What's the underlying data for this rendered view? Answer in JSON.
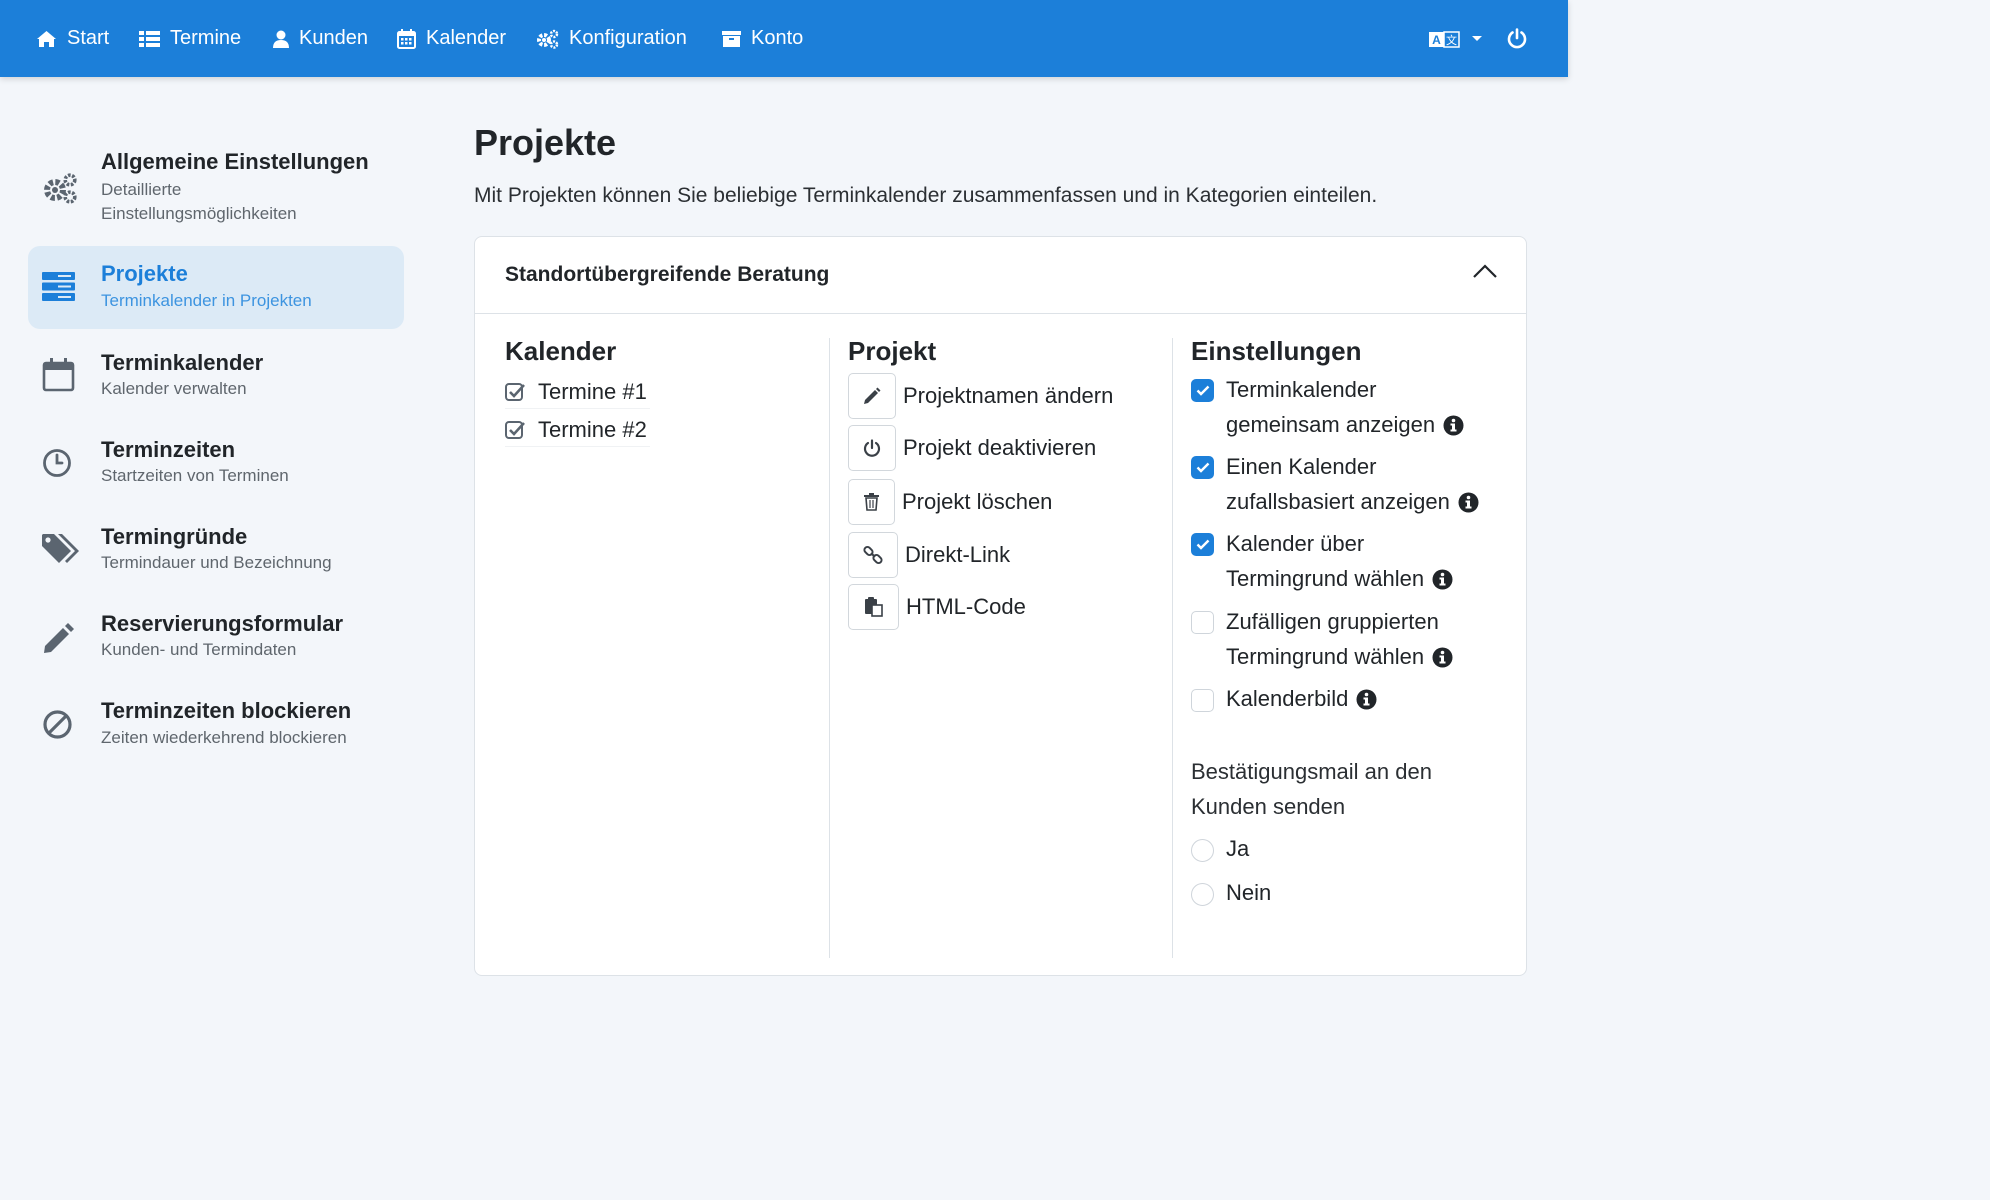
{
  "nav": {
    "items": [
      {
        "label": "Start",
        "icon": "home-icon"
      },
      {
        "label": "Termine",
        "icon": "list-icon"
      },
      {
        "label": "Kunden",
        "icon": "user-icon"
      },
      {
        "label": "Kalender",
        "icon": "calendar-icon"
      },
      {
        "label": "Konfiguration",
        "icon": "cogs-icon"
      },
      {
        "label": "Konto",
        "icon": "archive-icon"
      }
    ],
    "right": {
      "language_icon": "translate-icon",
      "logout_icon": "power-icon"
    },
    "colors": {
      "bar": "#1c7fd9",
      "text": "#ffffff"
    }
  },
  "sidebar": {
    "items": [
      {
        "title": "Allgemeine Einstellungen",
        "subtitle": "Detaillierte Einstellungsmöglichkeiten",
        "icon": "cogs-icon",
        "active": false
      },
      {
        "title": "Projekte",
        "subtitle": "Terminkalender in Projekten",
        "icon": "server-icon",
        "active": true
      },
      {
        "title": "Terminkalender",
        "subtitle": "Kalender verwalten",
        "icon": "calendar-icon",
        "active": false
      },
      {
        "title": "Terminzeiten",
        "subtitle": "Startzeiten von Terminen",
        "icon": "clock-icon",
        "active": false
      },
      {
        "title": "Termingründe",
        "subtitle": "Termindauer und Bezeichnung",
        "icon": "tags-icon",
        "active": false
      },
      {
        "title": "Reservierungsformular",
        "subtitle": "Kunden- und Termindaten",
        "icon": "pencil-icon",
        "active": false
      },
      {
        "title": "Terminzeiten blockieren",
        "subtitle": "Zeiten wiederkehrend blockieren",
        "icon": "ban-icon",
        "active": false
      }
    ],
    "colors": {
      "active_bg": "#dceaf6",
      "active_text": "#1c7fd9"
    }
  },
  "main": {
    "title": "Projekte",
    "description": "Mit Projekten können Sie beliebige Terminkalender zusammenfassen und in Kategorien einteilen.",
    "card": {
      "title": "Standortübergreifende Beratung",
      "kalender": {
        "heading": "Kalender",
        "items": [
          "Termine #1",
          "Termine #2"
        ]
      },
      "projekt": {
        "heading": "Projekt",
        "actions": [
          {
            "label": "Projektnamen ändern",
            "icon": "pencil-icon"
          },
          {
            "label": "Projekt deaktivieren",
            "icon": "power-icon"
          },
          {
            "label": "Projekt löschen",
            "icon": "trash-icon"
          },
          {
            "label": "Direkt-Link",
            "icon": "link-icon"
          },
          {
            "label": "HTML-Code",
            "icon": "paste-icon"
          }
        ]
      },
      "einstellungen": {
        "heading": "Einstellungen",
        "options": [
          {
            "line1": "Terminkalender",
            "line2": "gemeinsam anzeigen",
            "checked": true
          },
          {
            "line1": "Einen Kalender",
            "line2": "zufallsbasiert anzeigen",
            "checked": true
          },
          {
            "line1": "Kalender über",
            "line2": "Termingrund wählen",
            "checked": true
          },
          {
            "line1": "Zufälligen gruppierten",
            "line2": "Termingrund wählen",
            "checked": false
          },
          {
            "line1": "Kalenderbild",
            "line2": "",
            "checked": false
          }
        ],
        "mail_label_1": "Bestätigungsmail an den",
        "mail_label_2": "Kunden senden",
        "radio": [
          "Ja",
          "Nein"
        ]
      }
    }
  }
}
